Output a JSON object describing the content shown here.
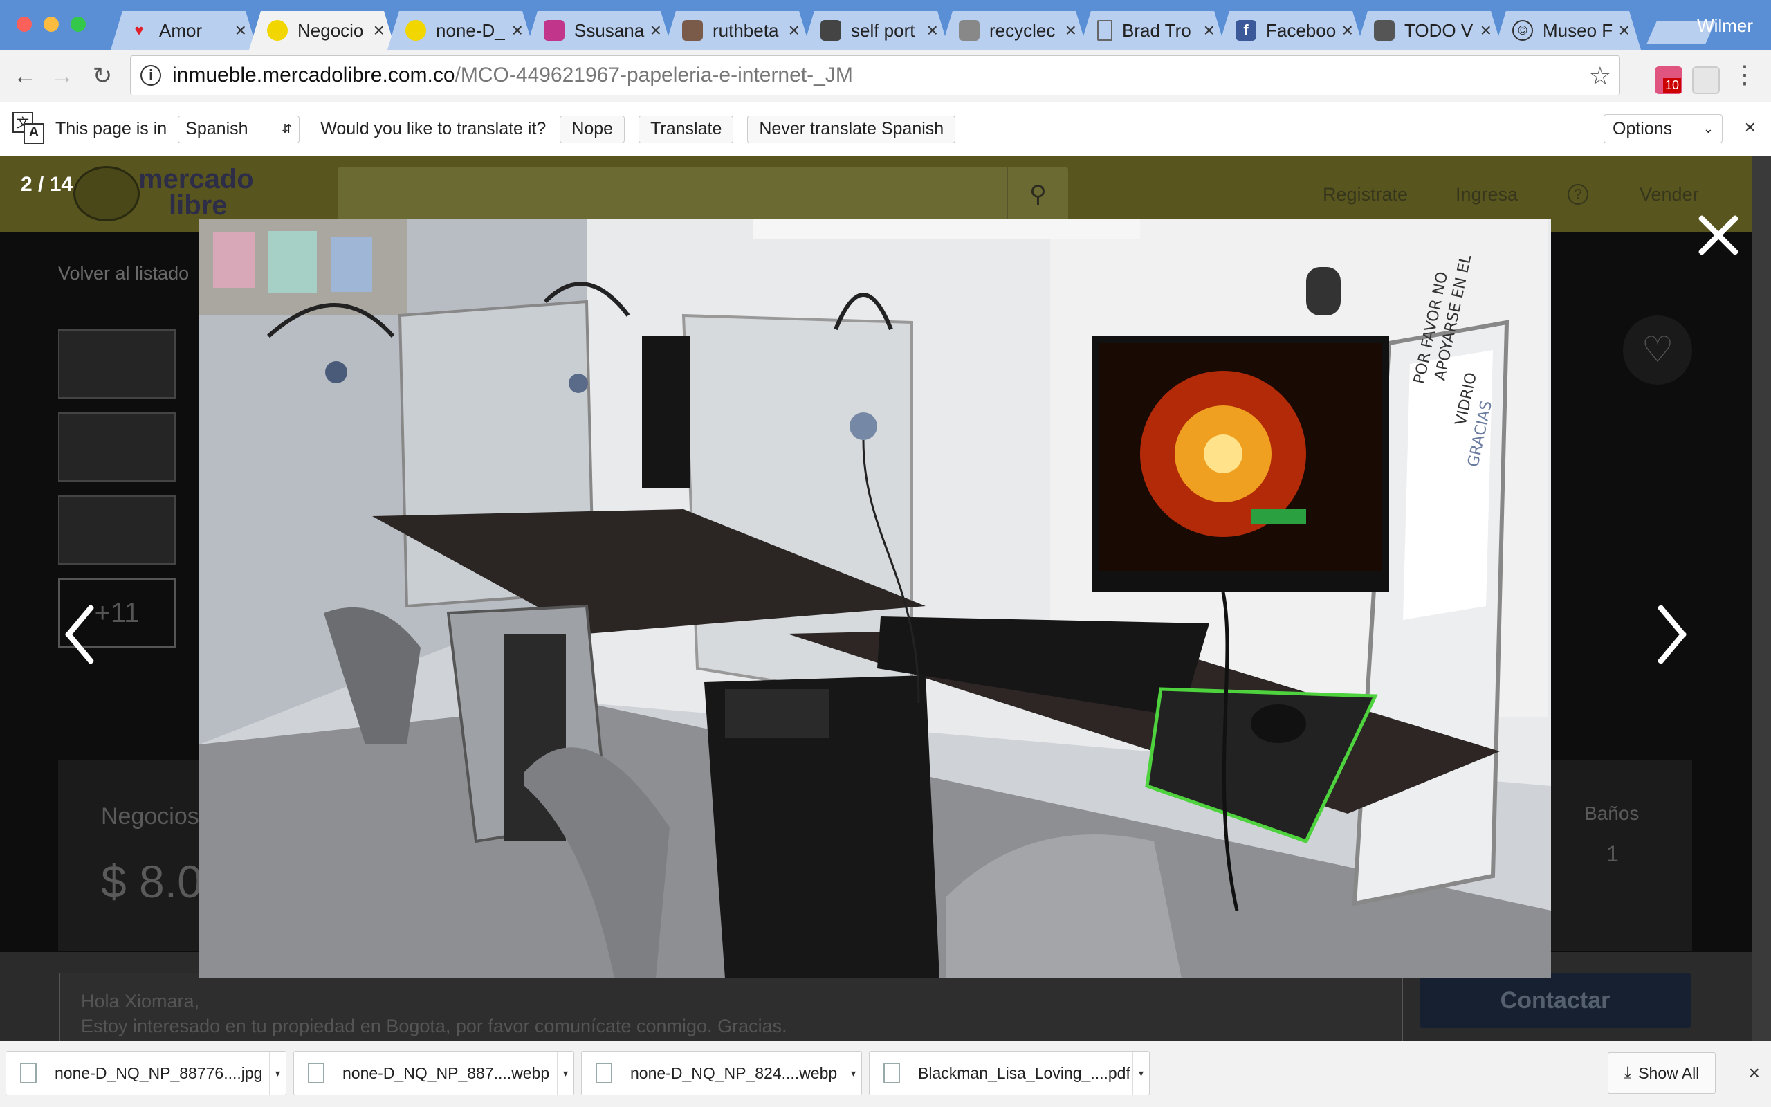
{
  "window": {
    "profile_name": "Wilmer"
  },
  "tabs": [
    {
      "title": "Amor",
      "icon": "heart-icon",
      "color": "#e0202b"
    },
    {
      "title": "Negocio",
      "icon": "mercadolibre-icon",
      "color": "#f1d600",
      "active": true
    },
    {
      "title": "none-D_",
      "icon": "mercadolibre-icon",
      "color": "#f1d600"
    },
    {
      "title": "Ssusana",
      "icon": "instagram-icon",
      "color": "#c1358a"
    },
    {
      "title": "ruthbeta",
      "icon": "image-icon",
      "color": "#7a5a48"
    },
    {
      "title": "self port",
      "icon": "image-icon",
      "color": "#444444"
    },
    {
      "title": "recyclec",
      "icon": "image-icon",
      "color": "#888888"
    },
    {
      "title": "Brad Tro",
      "icon": "page-icon",
      "color": "#666666"
    },
    {
      "title": "Faceboo",
      "icon": "facebook-icon",
      "color": "#3b5998"
    },
    {
      "title": "TODO V",
      "icon": "image-icon",
      "color": "#555555"
    },
    {
      "title": "Museo F",
      "icon": "copyright-icon",
      "color": "#333333"
    }
  ],
  "toolbar": {
    "url_host": "inmueble.mercadolibre.com.co",
    "url_path": "/MCO-449621967-papeleria-e-internet-_JM",
    "extension_badge": "10"
  },
  "translate_bar": {
    "prefix": "This page is in",
    "language": "Spanish",
    "question": "Would you like to translate it?",
    "nope": "Nope",
    "translate": "Translate",
    "never": "Never translate Spanish",
    "options": "Options"
  },
  "page": {
    "logo_text_1": "mercado",
    "logo_text_2": "libre",
    "nav": {
      "register": "Registrate",
      "login": "Ingresa",
      "help": "?",
      "sell": "Vender"
    },
    "back_link": "Volver al listado",
    "more_photos": "+11",
    "category": "Negocios",
    "price": "$ 8.0",
    "bathrooms_label": "Baños",
    "bathrooms_value": "1",
    "message_line1": "Hola Xiomara,",
    "message_line2": "Estoy interesado en tu propiedad en Bogota, por favor comunícate conmigo. Gracias.",
    "contact_button": "Contactar"
  },
  "lightbox": {
    "counter": "2 / 14",
    "photo_sign_text": "POR FAVOR NO APOYARSE EN EL VIDRIO GRACIAS",
    "photo_sign_line1": "POR FAVOR NO",
    "photo_sign_line2": "APOYARSE EN EL",
    "photo_sign_line3": "VIDRIO",
    "photo_sign_line4": "GRACIAS"
  },
  "downloads": {
    "items": [
      {
        "name": "none-D_NQ_NP_88776....jpg"
      },
      {
        "name": "none-D_NQ_NP_887....webp"
      },
      {
        "name": "none-D_NQ_NP_824....webp"
      },
      {
        "name": "Blackman_Lisa_Loving_....pdf"
      }
    ],
    "show_all": "Show All"
  }
}
